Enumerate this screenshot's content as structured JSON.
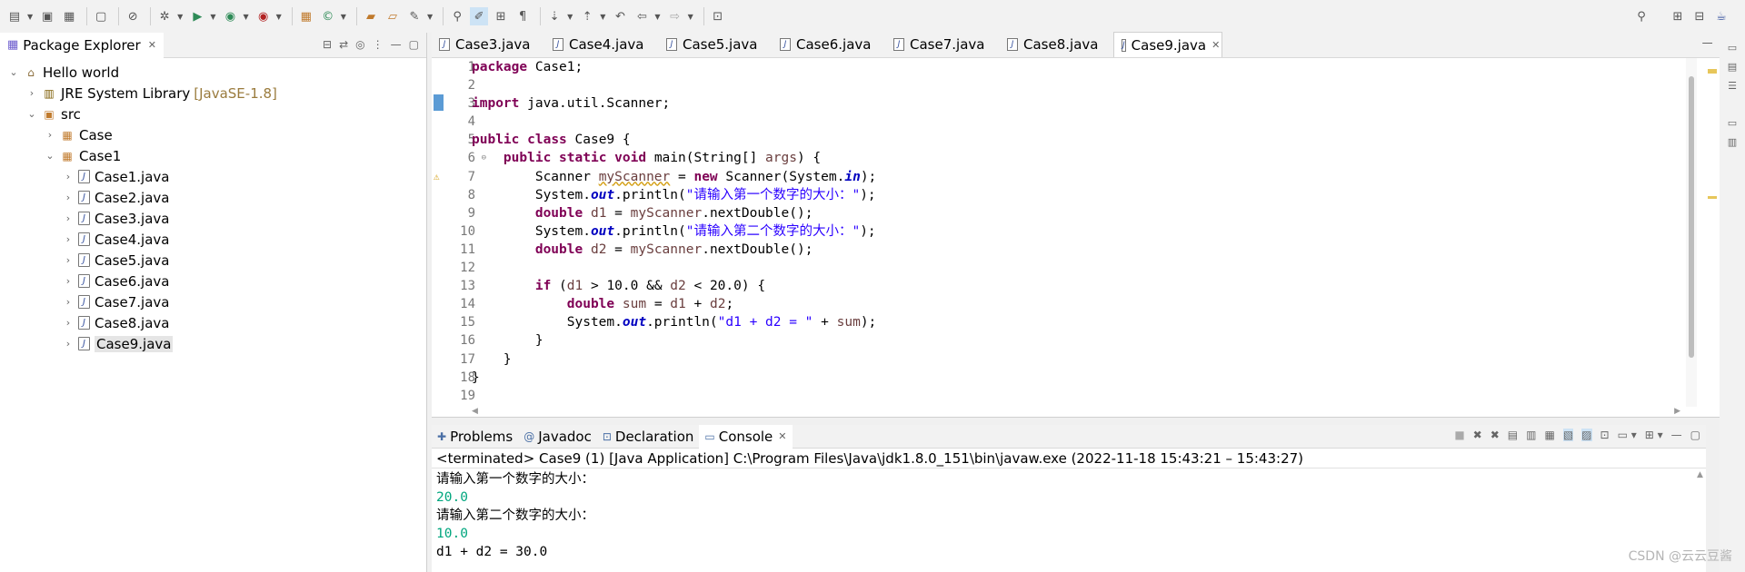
{
  "explorer": {
    "title": "Package Explorer",
    "tree": [
      {
        "label": "Hello world",
        "type": "project",
        "expanded": true,
        "depth": 0
      },
      {
        "label": "JRE System Library",
        "tag": "[JavaSE-1.8]",
        "type": "library",
        "expanded": false,
        "depth": 1
      },
      {
        "label": "src",
        "type": "folder",
        "expanded": true,
        "depth": 1
      },
      {
        "label": "Case",
        "type": "package",
        "expanded": false,
        "depth": 2
      },
      {
        "label": "Case1",
        "type": "package",
        "expanded": true,
        "depth": 2
      },
      {
        "label": "Case1.java",
        "type": "java",
        "depth": 3
      },
      {
        "label": "Case2.java",
        "type": "java",
        "depth": 3
      },
      {
        "label": "Case3.java",
        "type": "java",
        "depth": 3
      },
      {
        "label": "Case4.java",
        "type": "java",
        "depth": 3
      },
      {
        "label": "Case5.java",
        "type": "java",
        "depth": 3
      },
      {
        "label": "Case6.java",
        "type": "java",
        "depth": 3
      },
      {
        "label": "Case7.java",
        "type": "java",
        "depth": 3
      },
      {
        "label": "Case8.java",
        "type": "java",
        "depth": 3
      },
      {
        "label": "Case9.java",
        "type": "java",
        "depth": 3,
        "selected": true
      }
    ]
  },
  "editor": {
    "tabs": [
      {
        "label": "Case3.java"
      },
      {
        "label": "Case4.java"
      },
      {
        "label": "Case5.java"
      },
      {
        "label": "Case6.java"
      },
      {
        "label": "Case7.java"
      },
      {
        "label": "Case8.java"
      },
      {
        "label": "Case9.java",
        "active": true
      }
    ],
    "line_numbers": [
      "1",
      "2",
      "3",
      "4",
      "5",
      "6",
      "7",
      "8",
      "9",
      "10",
      "11",
      "12",
      "13",
      "14",
      "15",
      "16",
      "17",
      "18",
      "19"
    ]
  },
  "console": {
    "tabs": [
      {
        "label": "Problems",
        "icon": "problems-icon"
      },
      {
        "label": "Javadoc",
        "icon": "javadoc-icon"
      },
      {
        "label": "Declaration",
        "icon": "declaration-icon"
      },
      {
        "label": "Console",
        "icon": "console-icon",
        "active": true
      }
    ],
    "terminated": "<terminated> Case9 (1) [Java Application] C:\\Program Files\\Java\\jdk1.8.0_151\\bin\\javaw.exe  (2022-11-18 15:43:21 – 15:43:27)",
    "output": [
      {
        "text": "请输入第一个数字的大小：",
        "kind": "stdout"
      },
      {
        "text": "20.0",
        "kind": "stdin"
      },
      {
        "text": "请输入第二个数字的大小：",
        "kind": "stdout"
      },
      {
        "text": "10.0",
        "kind": "stdin"
      },
      {
        "text": "d1 + d2 = 30.0",
        "kind": "stdout"
      }
    ]
  },
  "watermark": "CSDN @云云豆酱",
  "colors": {
    "keyword": "#7f0055",
    "string": "#2a00ff",
    "static_field": "#0000c0",
    "local_var": "#6a3e3e",
    "console_input": "#00a67e"
  }
}
